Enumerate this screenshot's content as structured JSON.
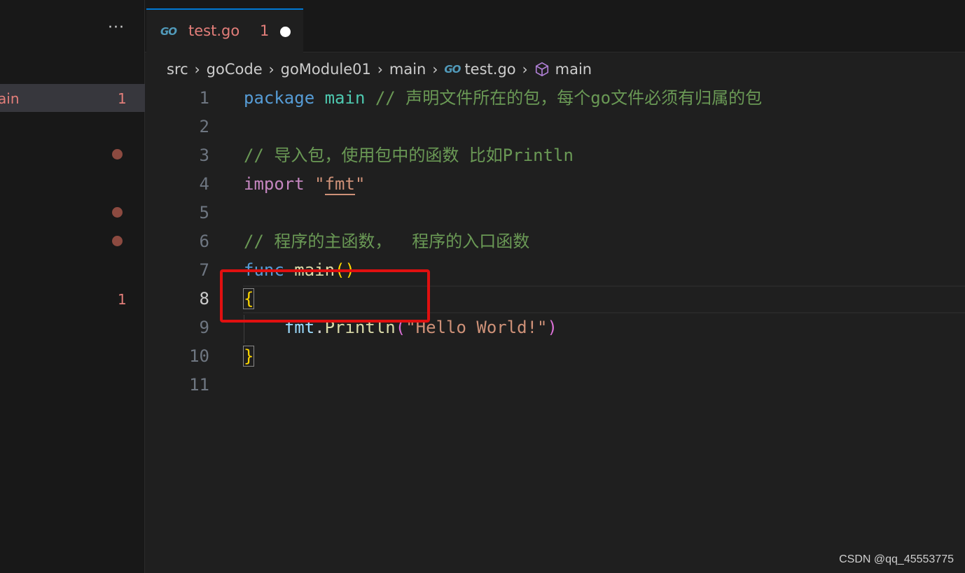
{
  "sidebar": {
    "more_label": "···",
    "selected_item": {
      "label": "ain",
      "badge": "1"
    },
    "second_badge": "1"
  },
  "tab": {
    "icon": "go-file-icon",
    "icon_text": "GO",
    "name": "test.go",
    "problem_count": "1",
    "dirty": true
  },
  "breadcrumb": {
    "parts": [
      "src",
      "goCode",
      "goModule01",
      "main"
    ],
    "file": "test.go",
    "symbol": "main"
  },
  "editor": {
    "line_numbers": [
      "1",
      "2",
      "3",
      "4",
      "5",
      "6",
      "7",
      "8",
      "9",
      "10",
      "11"
    ],
    "active_line": "8",
    "lines": {
      "l1_kw": "package",
      "l1_pkg": "main",
      "l1_comment": "// 声明文件所在的包，每个go文件必须有归属的包",
      "l3_comment": "// 导入包，使用包中的函数 比如Println",
      "l4_kw": "import",
      "l4_q1": "\"",
      "l4_str": "fmt",
      "l4_q2": "\"",
      "l6_comment": "// 程序的主函数，  程序的入口函数",
      "l7_kw": "func",
      "l7_fn": "main",
      "l7_paren": "()",
      "l8_brace": "{",
      "l9_pkg": "fmt",
      "l9_dot": ".",
      "l9_fn": "Println",
      "l9_open": "(",
      "l9_str": "\"Hello World!\"",
      "l9_close": ")",
      "l10_brace": "}"
    }
  },
  "watermark": "CSDN @qq_45553775",
  "colors": {
    "accent": "#0078d4",
    "error": "#e37e7a",
    "annotation": "#e01010"
  }
}
